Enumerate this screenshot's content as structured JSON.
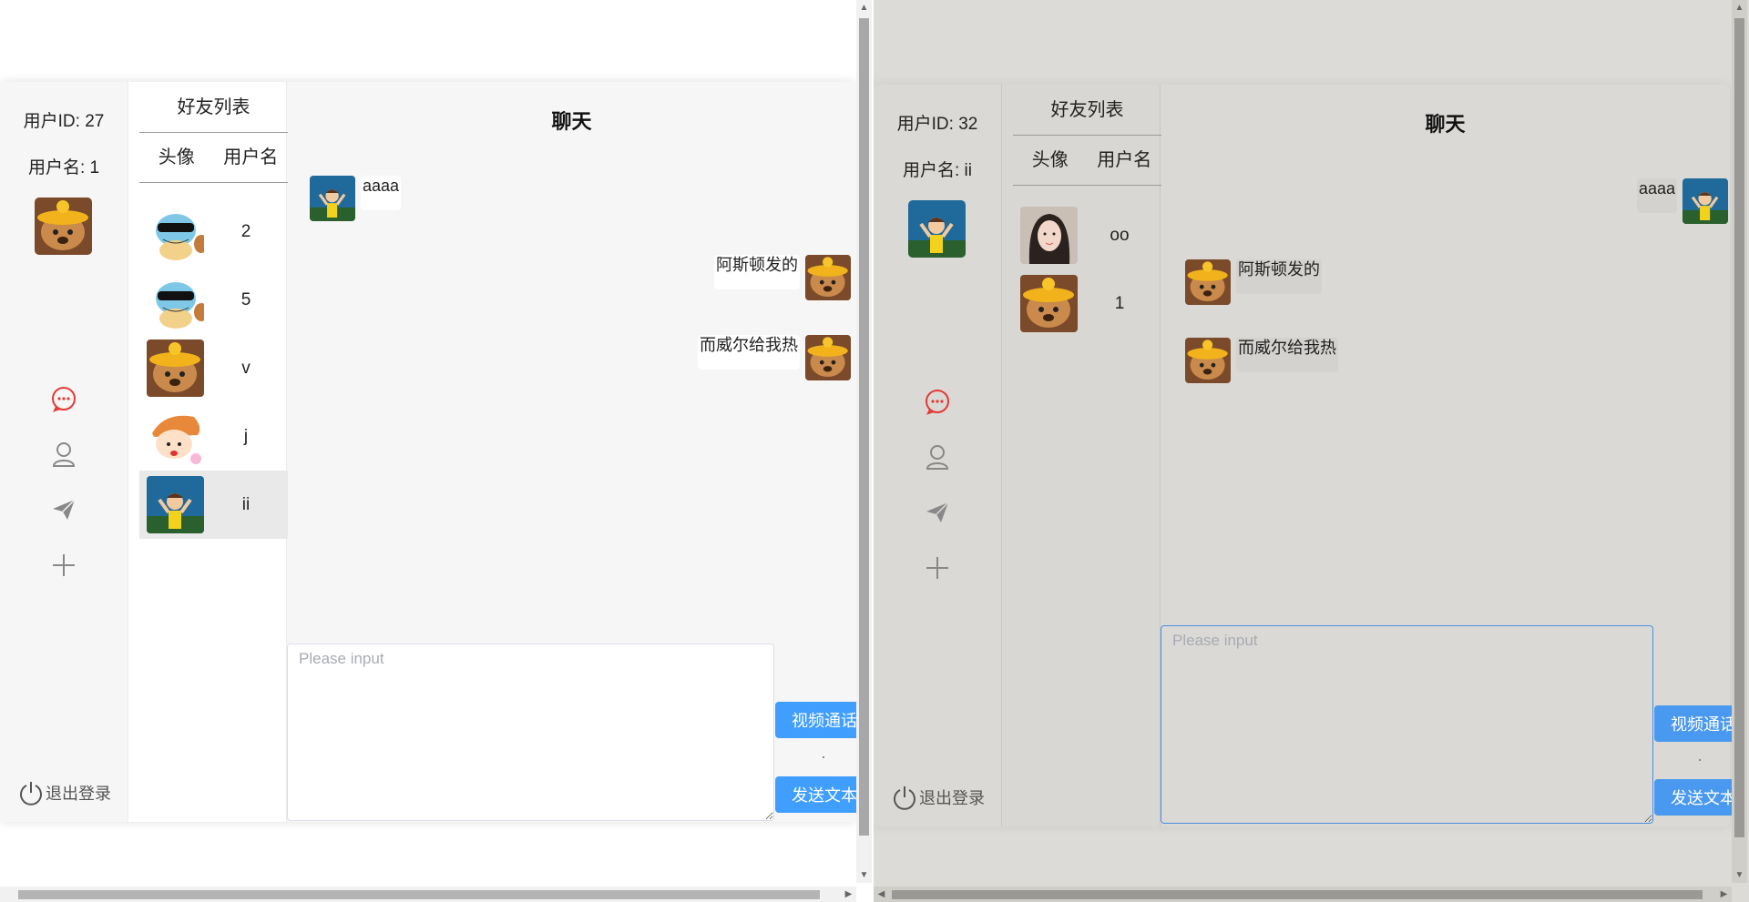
{
  "left": {
    "user_id": "用户ID: 27",
    "user_name": "用户名: 1",
    "friends_title": "好友列表",
    "col_avatar": "头像",
    "col_name": "用户名",
    "friends": [
      {
        "name": "2",
        "avatar": "squirtle"
      },
      {
        "name": "5",
        "avatar": "squirtle"
      },
      {
        "name": "v",
        "avatar": "bear"
      },
      {
        "name": "j",
        "avatar": "cartoon-girl"
      },
      {
        "name": "ii",
        "avatar": "blue-kid",
        "active": true
      }
    ],
    "chat_title": "聊天",
    "messages": [
      {
        "text": "aaaa",
        "side": "left",
        "avatar": "blue-kid"
      },
      {
        "text": "阿斯顿发的",
        "side": "right",
        "avatar": "bear"
      },
      {
        "text": "而威尔给我热",
        "side": "right",
        "avatar": "bear"
      }
    ],
    "input_placeholder": "Please input",
    "video_btn": "视频通话",
    "send_btn": "发送文本",
    "logout": "退出登录"
  },
  "right": {
    "user_id": "用户ID: 32",
    "user_name": "用户名: ii",
    "friends_title": "好友列表",
    "col_avatar": "头像",
    "col_name": "用户名",
    "friends": [
      {
        "name": "oo",
        "avatar": "photo-woman"
      },
      {
        "name": "1",
        "avatar": "bear"
      }
    ],
    "chat_title": "聊天",
    "messages": [
      {
        "text": "aaaa",
        "side": "right",
        "avatar": "blue-kid"
      },
      {
        "text": "阿斯顿发的",
        "side": "left",
        "avatar": "bear"
      },
      {
        "text": "而威尔给我热",
        "side": "left",
        "avatar": "bear"
      }
    ],
    "input_placeholder": "Please input",
    "video_btn": "视频通话",
    "send_btn": "发送文本",
    "logout": "退出登录"
  },
  "colors": {
    "accent": "#409eff",
    "chat_icon_active": "#e53935",
    "icon_gray": "#888888"
  },
  "icons": [
    "chat-bubble-icon",
    "user-icon",
    "paper-plane-icon",
    "plus-icon",
    "power-icon"
  ]
}
